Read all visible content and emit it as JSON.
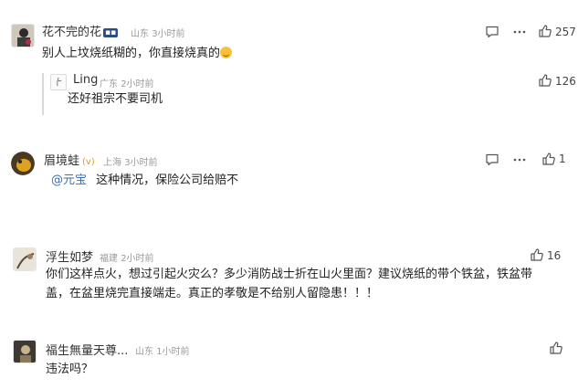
{
  "comments": [
    {
      "name": "花不完的花",
      "location": "山东",
      "time": "3小时前",
      "likes": "257",
      "text": "别人上坟烧纸糊的，你直接烧真的",
      "reply": {
        "name": "Ling",
        "location": "广东",
        "time": "2小时前",
        "likes": "126",
        "text": "还好祖宗不要司机"
      }
    },
    {
      "name": "眉境蛙",
      "location": "上海",
      "time": "3小时前",
      "likes": "1",
      "mention": "@元宝",
      "text": "这种情况，保险公司给赔不"
    },
    {
      "name": "浮生如梦",
      "location": "福建",
      "time": "2小时前",
      "likes": "16",
      "text_line1": "你们这样点火，想过引起火灾么？多少消防战士折在山火里面？建议烧纸的带个铁盆，铁盆带",
      "text_line2": "盖，在盆里烧完直接端走。真正的孝敬是不给别人留隐患！！！"
    },
    {
      "name": "福生無量天尊...",
      "location": "山东",
      "time": "1小时前",
      "text": "违法吗？"
    }
  ]
}
